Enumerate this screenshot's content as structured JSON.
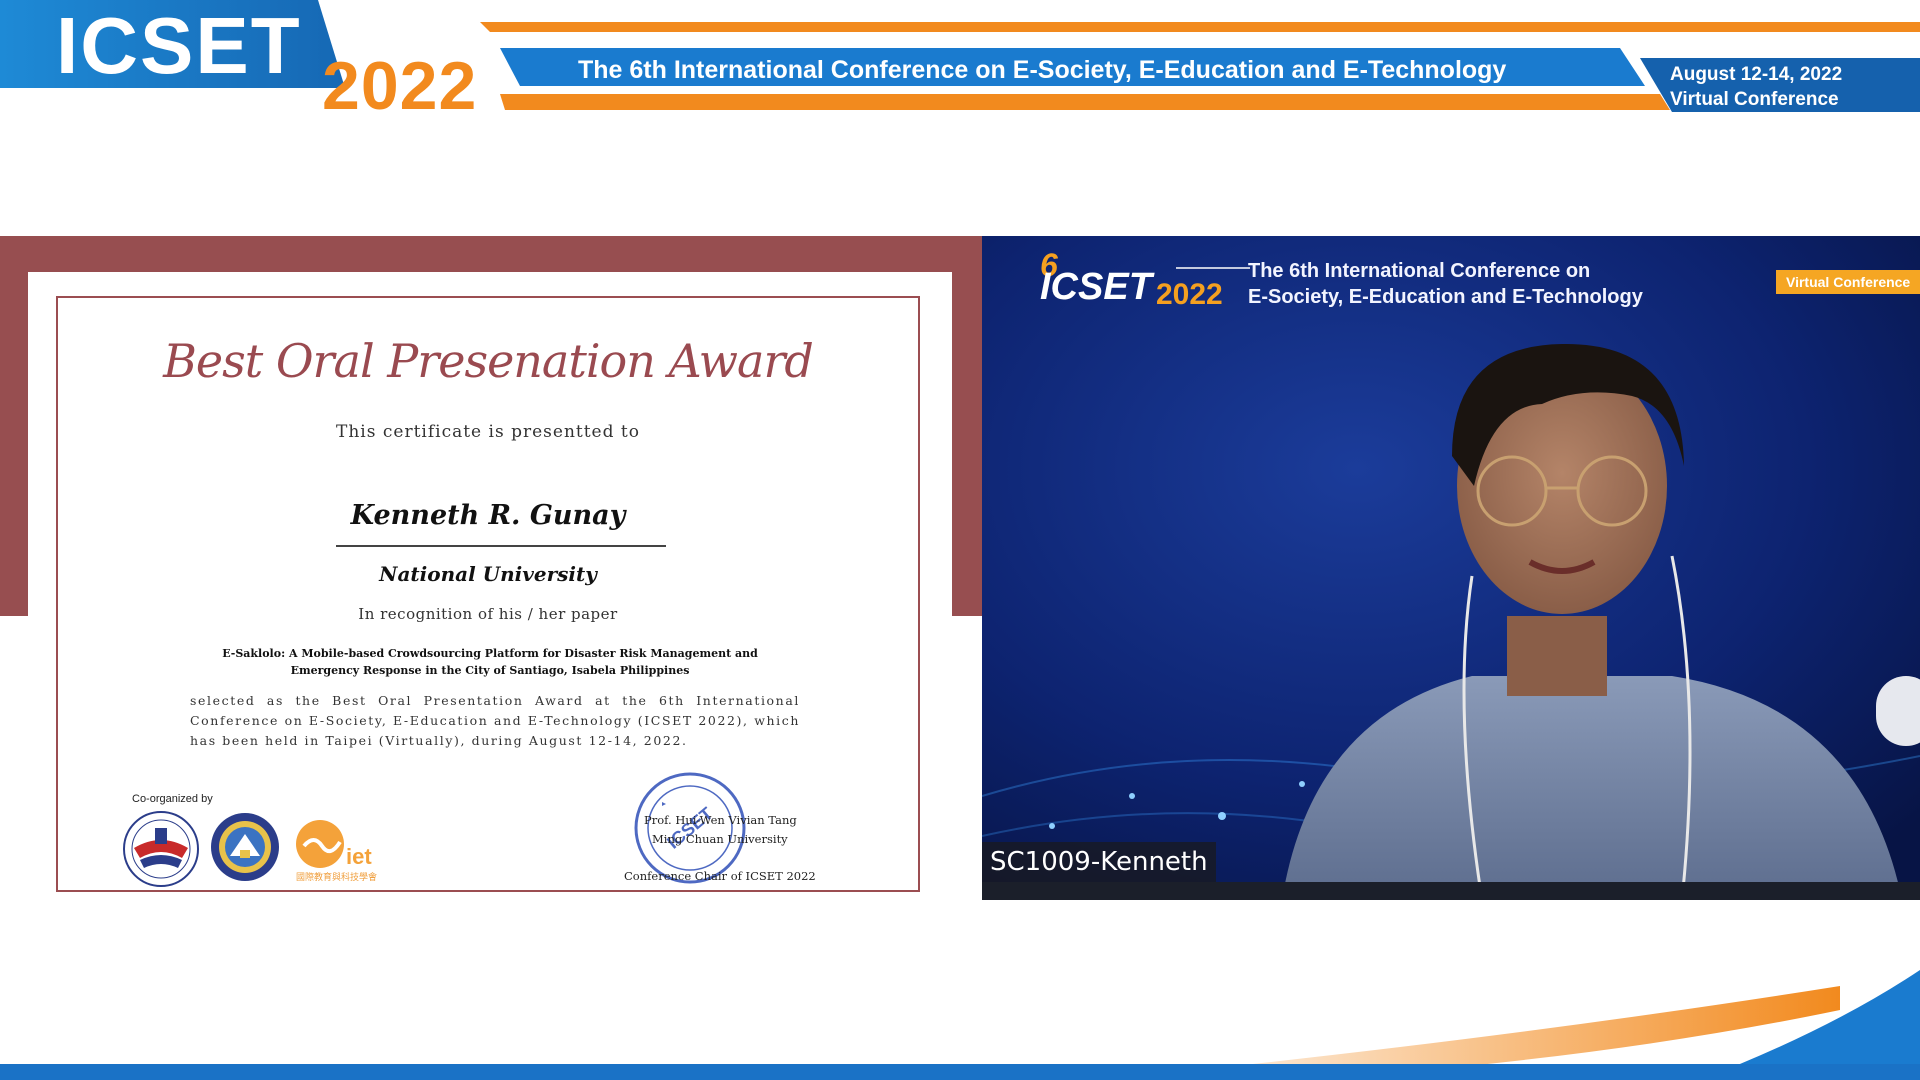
{
  "banner": {
    "logo_text": "ICSET",
    "logo_year": "2022",
    "title": "The 6th International Conference on E-Society, E-Education and E-Technology",
    "date": "August 12-14, 2022",
    "mode": "Virtual Conference"
  },
  "certificate": {
    "title": "Best Oral Presenation Award",
    "presented_to": "This certificate is presentted to",
    "recipient": "Kenneth R. Gunay",
    "affiliation": "National University",
    "recognition": "In recognition of his / her paper",
    "paper_title": "E-Saklolo: A Mobile-based Crowdsourcing Platform for Disaster Risk Management and Emergency Response in the City of Santiago, Isabela Philippines",
    "body": "selected as the Best Oral Presentation Award at the 6th International Conference on E-Society, E-Education and E-Technology (ICSET 2022), which has been held in Taipei (Virtually), during August 12-14, 2022.",
    "coorganized_label": "Co-organized by",
    "iet_text": "iet",
    "iet_subtitle": "國際教育與科技學會",
    "stamp_text": "ICSET",
    "signer_name": "Prof. Hui-Wen Vivian Tang",
    "signer_org": "Ming Chuan University",
    "signer_role": "Conference Chair of ICSET 2022"
  },
  "video": {
    "logo_text": "ICSET",
    "logo_year": "2022",
    "title_line1": "The 6th International Conference on",
    "title_line2": "E-Society, E-Education and E-Technology",
    "badge": "Virtual Conference",
    "participant_name": "SC1009-Kenneth"
  },
  "colors": {
    "banner_blue": "#1877c5",
    "banner_orange": "#f28a1e",
    "certificate_maroon": "#974e50",
    "video_navy": "#0b1a55"
  }
}
